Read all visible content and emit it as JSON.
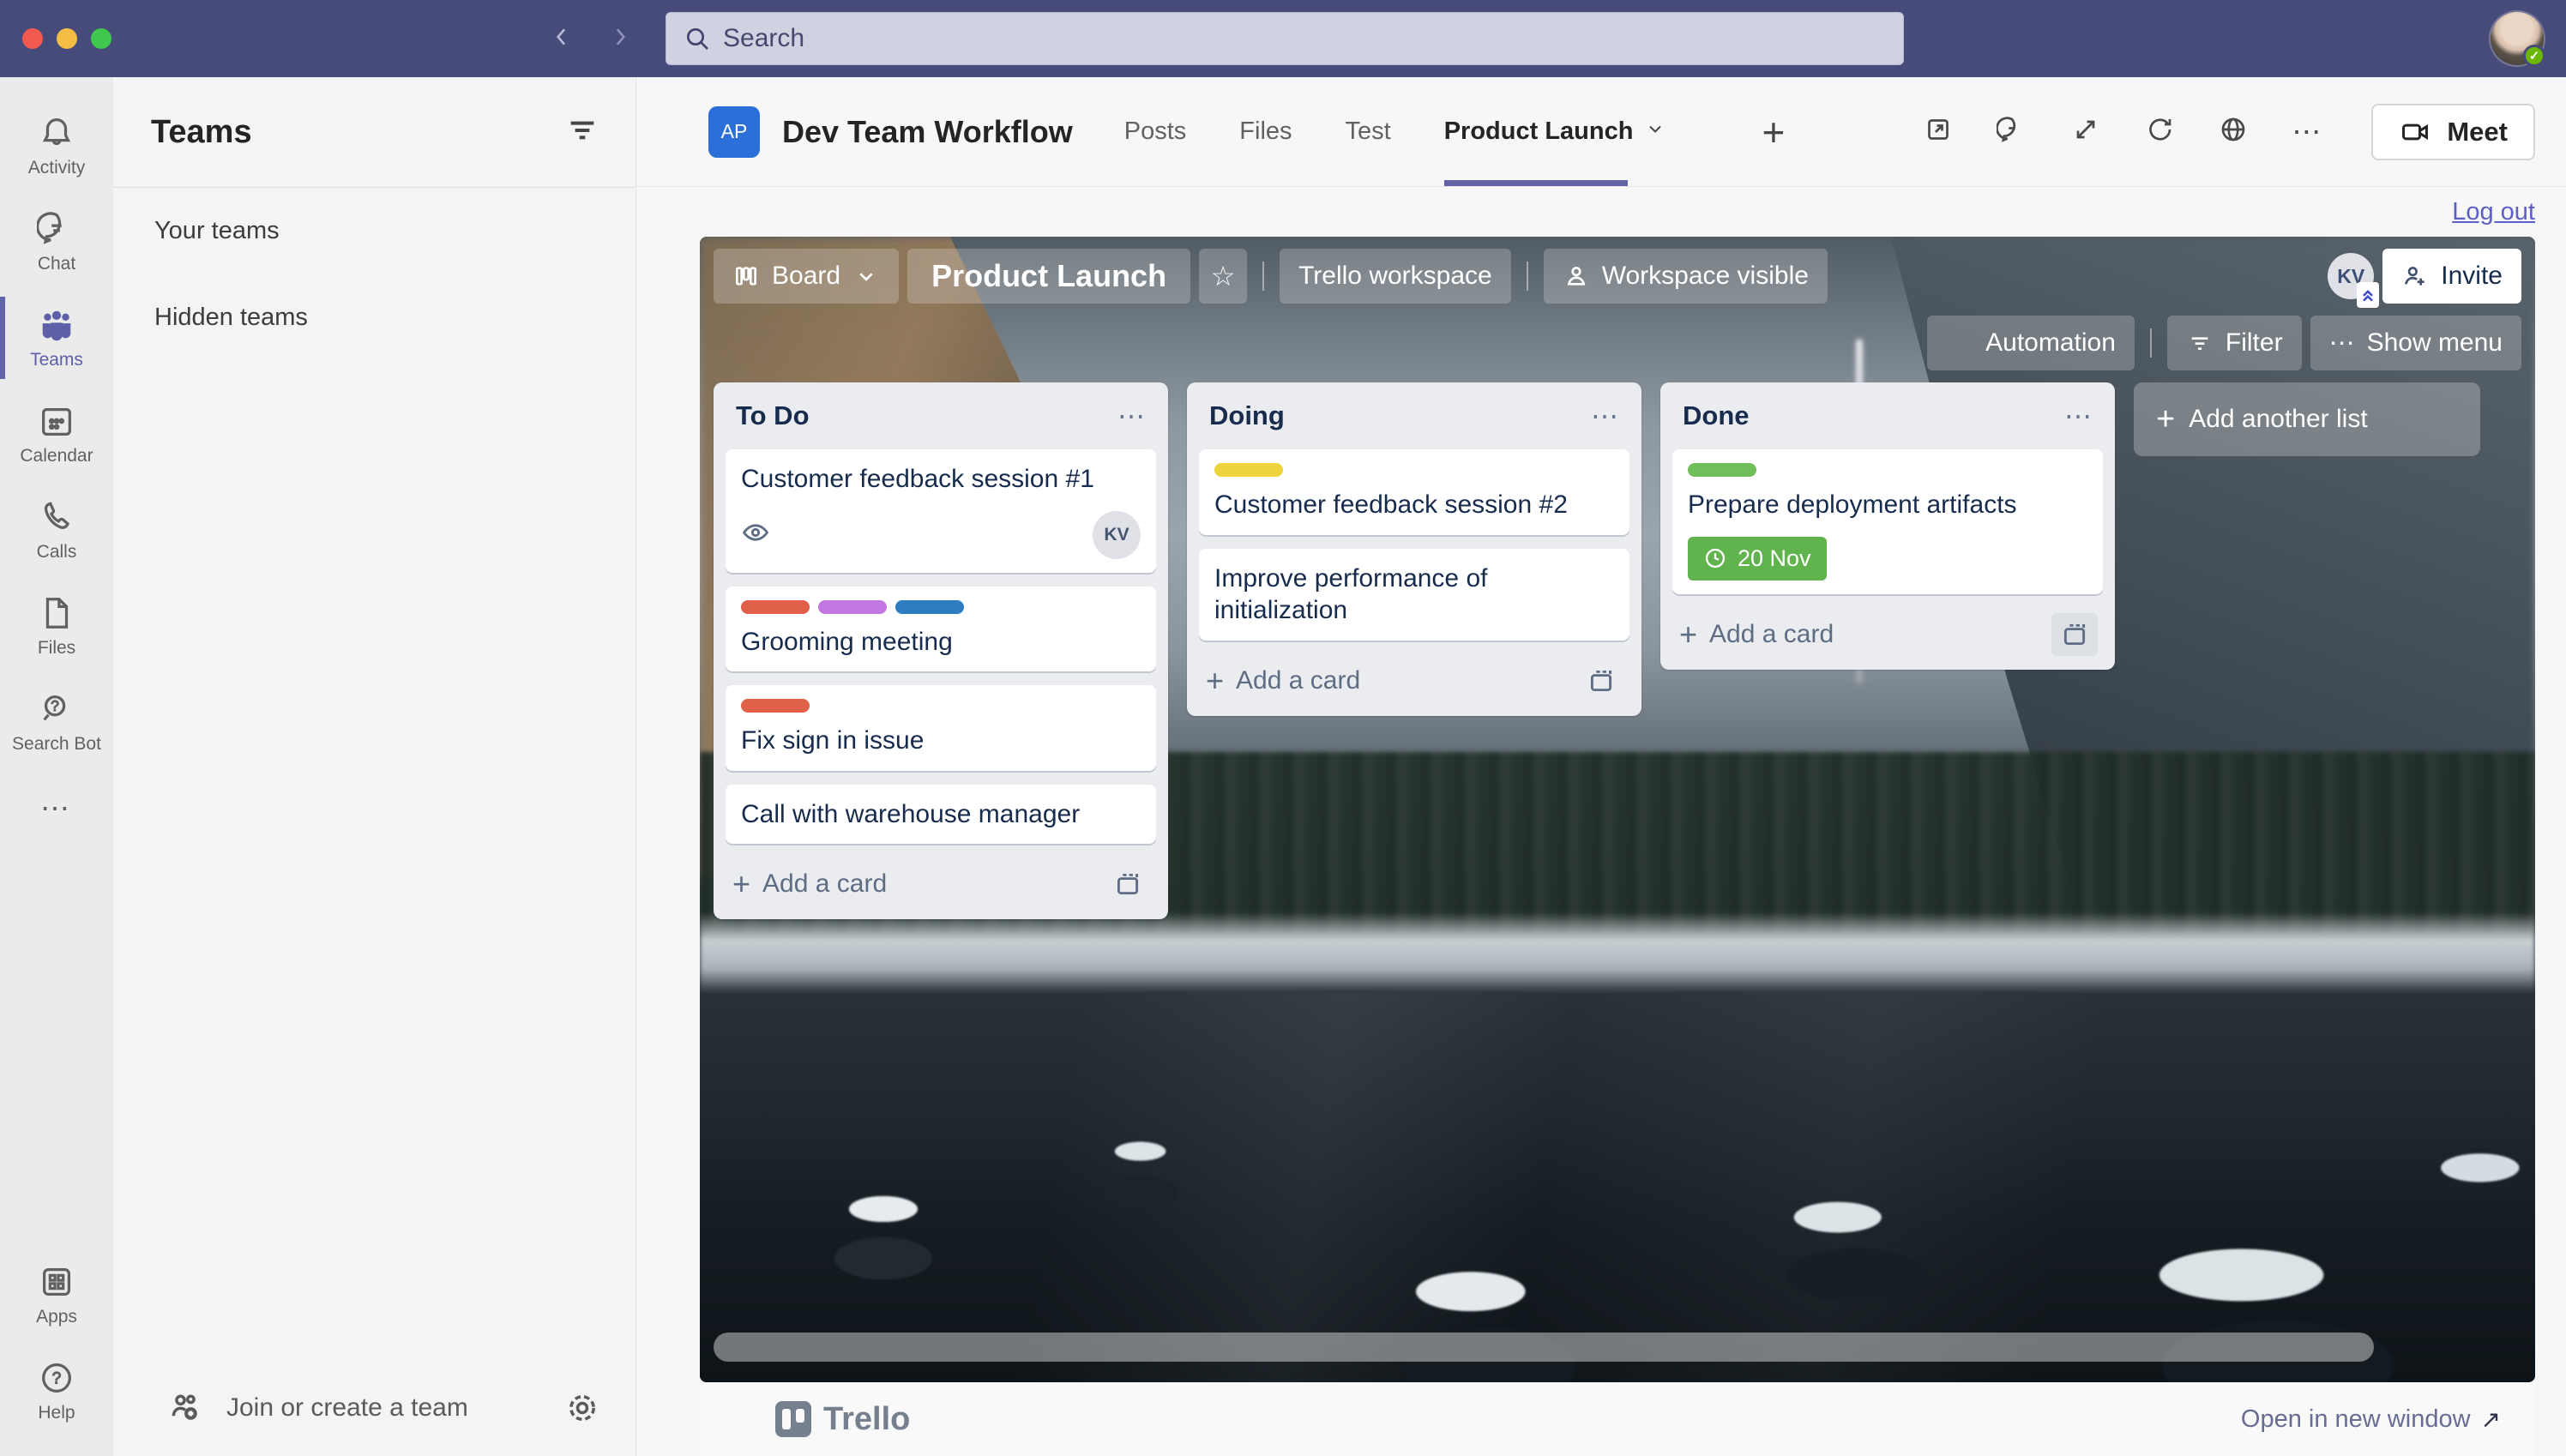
{
  "chrome": {
    "search_placeholder": "Search"
  },
  "icons": {
    "more_h": "⋯",
    "plus": "+",
    "star": "☆",
    "check": "✓",
    "external_arrow": "↗"
  },
  "rail": {
    "items": [
      {
        "label": "Activity"
      },
      {
        "label": "Chat"
      },
      {
        "label": "Teams"
      },
      {
        "label": "Calendar"
      },
      {
        "label": "Calls"
      },
      {
        "label": "Files"
      },
      {
        "label": "Search Bot"
      },
      {
        "label": "Apps"
      },
      {
        "label": "Help"
      }
    ]
  },
  "sidebar": {
    "title": "Teams",
    "your_teams": "Your teams",
    "hidden_teams": "Hidden teams",
    "join_label": "Join or create a team"
  },
  "channel": {
    "avatar_initials": "AP",
    "title": "Dev Team Workflow",
    "tabs": [
      {
        "label": "Posts"
      },
      {
        "label": "Files"
      },
      {
        "label": "Test"
      },
      {
        "label": "Product Launch"
      }
    ],
    "meet_label": "Meet"
  },
  "content": {
    "logout_label": "Log out"
  },
  "board": {
    "nav": {
      "board_label": "Board",
      "title": "Product Launch",
      "workspace_label": "Trello workspace",
      "visibility_label": "Workspace visible",
      "member_initials": "KV",
      "invite_label": "Invite"
    },
    "actions": {
      "automation_label": "Automation",
      "filter_label": "Filter",
      "show_menu_label": "Show menu"
    },
    "add_card_label": "Add a card",
    "add_list_label": "Add another list",
    "lists": [
      {
        "title": "To Do",
        "cards": [
          {
            "title": "Customer feedback session #1",
            "member": "KV"
          },
          {
            "title": "Grooming meeting",
            "labels": [
              "#e0604a",
              "#c377e0",
              "#2e7cc0"
            ]
          },
          {
            "title": "Fix sign in issue",
            "labels": [
              "#e0604a"
            ]
          },
          {
            "title": "Call with warehouse manager"
          }
        ]
      },
      {
        "title": "Doing",
        "cards": [
          {
            "title": "Customer feedback session #2",
            "labels": [
              "#eed53f"
            ]
          },
          {
            "title": "Improve performance of initialization"
          }
        ]
      },
      {
        "title": "Done",
        "cards": [
          {
            "title": "Prepare deployment artifacts",
            "labels": [
              "#6fbe5a"
            ],
            "due": "20 Nov"
          }
        ]
      }
    ]
  },
  "footer": {
    "brand": "Trello",
    "open_label": "Open in new window"
  }
}
